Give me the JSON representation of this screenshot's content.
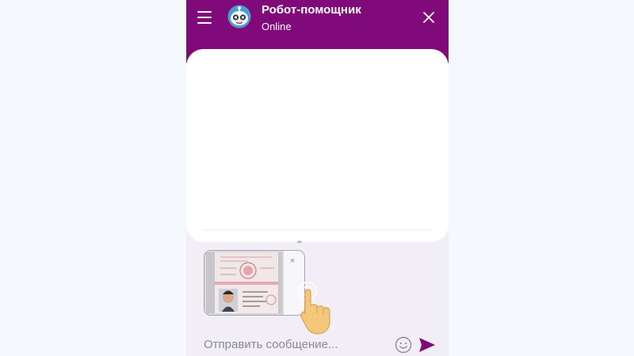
{
  "header": {
    "title": "Робот-помощник",
    "status": "Online",
    "menu_icon": "hamburger-menu-icon",
    "avatar_icon": "robot-avatar-icon",
    "close_icon": "close-icon"
  },
  "attachment": {
    "remove_label": "×",
    "preview": "passport-document-photo",
    "pointer_icon": "tap-hand-icon"
  },
  "composer": {
    "placeholder": "Отправить сообщение...",
    "emoji_icon": "smiley-icon",
    "send_icon": "send-arrow-icon"
  },
  "colors": {
    "brand": "#810a7a",
    "page_background": "#f5f9fe",
    "widget_background": "#f1eff5",
    "send_arrow": "#810a7a",
    "hand": "#f4c77a"
  }
}
